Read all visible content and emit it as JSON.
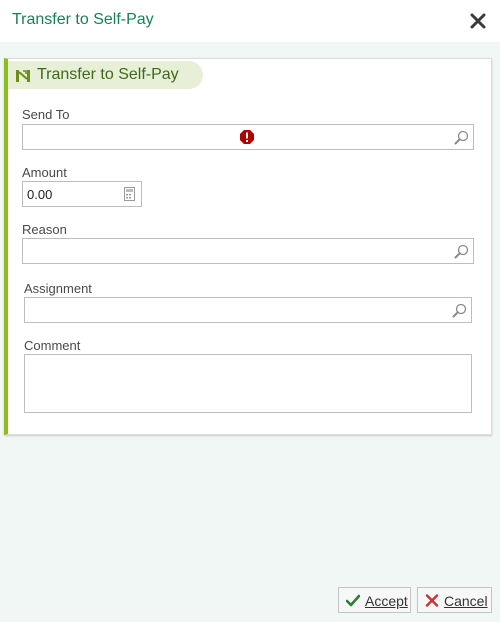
{
  "dialog": {
    "title": "Transfer to Self-Pay"
  },
  "panel": {
    "title": "Transfer to Self-Pay"
  },
  "form": {
    "send_to": {
      "label": "Send To",
      "value": ""
    },
    "amount": {
      "label": "Amount",
      "value": "0.00"
    },
    "reason": {
      "label": "Reason",
      "value": ""
    },
    "assignment": {
      "label": "Assignment",
      "value": ""
    },
    "comment": {
      "label": "Comment",
      "value": ""
    }
  },
  "buttons": {
    "accept": "Accept",
    "cancel": "Cancel"
  },
  "colors": {
    "title": "#1a7f57",
    "panel_accent": "#8bbd1b",
    "error": "#b00000",
    "accept_check": "#2e7d32",
    "cancel_x": "#d32f2f"
  }
}
